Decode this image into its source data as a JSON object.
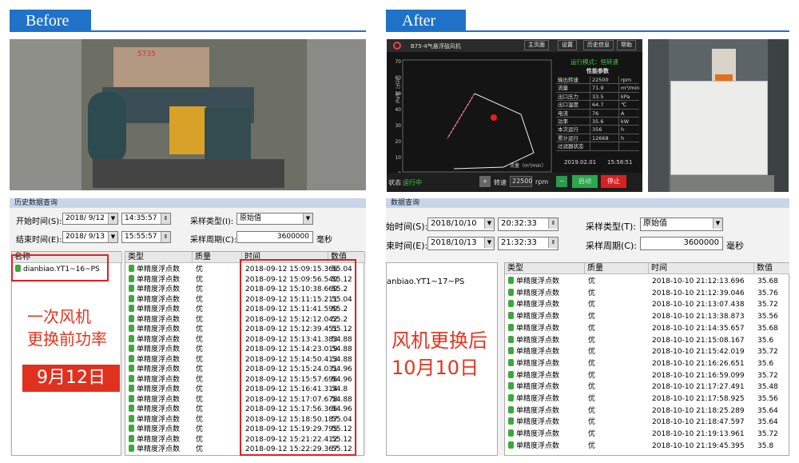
{
  "before": {
    "tag": "Before"
  },
  "after": {
    "tag": "After"
  },
  "scada": {
    "logo": "B75-4气悬浮鼓风机",
    "menu": [
      "主页面",
      "设置",
      "历史信息",
      "帮助"
    ],
    "mode": "运行模式：恒转速",
    "perf_title": "性能参数",
    "params": [
      {
        "k": "输出转速",
        "v": "22500",
        "u": "rpm"
      },
      {
        "k": "流量",
        "v": "71.9",
        "u": "m³/min"
      },
      {
        "k": "出口压力",
        "v": "33.5",
        "u": "kPa"
      },
      {
        "k": "出口温度",
        "v": "64.7",
        "u": "℃"
      },
      {
        "k": "电流",
        "v": "76",
        "u": "A"
      },
      {
        "k": "功率",
        "v": "35.6",
        "u": "kW"
      },
      {
        "k": "本次运行",
        "v": "356",
        "u": "h"
      },
      {
        "k": "累计运行",
        "v": "12668",
        "u": "h"
      },
      {
        "k": "过滤器状态",
        "v": "",
        "u": ""
      }
    ],
    "date": "2019.02.01",
    "time": "15:58:51",
    "ylabel": "压力（kPa）",
    "xlabel": "流量（m³/min）",
    "yticks": [
      "70",
      "60",
      "50",
      "40",
      "30",
      "20",
      "10",
      "0"
    ],
    "xticks": [
      "0",
      "10",
      "20",
      "30",
      "40",
      "50",
      "60",
      "70",
      "80",
      "90",
      "100",
      "110"
    ],
    "status_label": "状态",
    "status": "运行中",
    "plus": "+",
    "speed_label": "转速",
    "speed": "22500",
    "speed_unit": "rpm",
    "minus": "−",
    "start": "启动",
    "stop": "停止"
  },
  "left": {
    "title": "历史数据查询",
    "start_label": "开始时间(S):",
    "start_date": "2018/ 9/12",
    "start_time": "14:35:57",
    "end_label": "结束时间(E):",
    "end_date": "2018/ 9/13",
    "end_time": "15:55:57",
    "type_label": "采样类型(I):",
    "type_val": "原始值",
    "period_label": "采样周期(C):",
    "period_val": "3600000",
    "period_unit": "毫秒",
    "tag_col": "名称",
    "tag": "dianbiao.YT1~16~PS",
    "headers": [
      "类型",
      "质量",
      "时间",
      "数值"
    ],
    "rows": [
      [
        "单精度浮点数",
        "优",
        "2018-09-12 15:09:15.366",
        "55.04"
      ],
      [
        "单精度浮点数",
        "优",
        "2018-09-12 15:09:56.540",
        "55.12"
      ],
      [
        "单精度浮点数",
        "优",
        "2018-09-12 15:10:38.660",
        "55.2"
      ],
      [
        "单精度浮点数",
        "优",
        "2018-09-12 15:11:15.211",
        "55.04"
      ],
      [
        "单精度浮点数",
        "优",
        "2018-09-12 15:11:41.590",
        "55.2"
      ],
      [
        "单精度浮点数",
        "优",
        "2018-09-12 15:12:12.042",
        "55.2"
      ],
      [
        "单精度浮点数",
        "优",
        "2018-09-12 15:12:39.451",
        "55.12"
      ],
      [
        "单精度浮点数",
        "优",
        "2018-09-12 15:13:41.383",
        "54.88"
      ],
      [
        "单精度浮点数",
        "优",
        "2018-09-12 15:14:23.019",
        "54.88"
      ],
      [
        "单精度浮点数",
        "优",
        "2018-09-12 15:14:50.413",
        "54.88"
      ],
      [
        "单精度浮点数",
        "优",
        "2018-09-12 15:15:24.031",
        "54.96"
      ],
      [
        "单精度浮点数",
        "优",
        "2018-09-12 15:15:57.696",
        "54.96"
      ],
      [
        "单精度浮点数",
        "优",
        "2018-09-12 15:16:41.314",
        "54.8"
      ],
      [
        "单精度浮点数",
        "优",
        "2018-09-12 15:17:07.678",
        "54.88"
      ],
      [
        "单精度浮点数",
        "优",
        "2018-09-12 15:17:56.366",
        "54.96"
      ],
      [
        "单精度浮点数",
        "优",
        "2018-09-12 15:18:50.187",
        "55.04"
      ],
      [
        "单精度浮点数",
        "优",
        "2018-09-12 15:19:29.795",
        "55.12"
      ],
      [
        "单精度浮点数",
        "优",
        "2018-09-12 15:21:22.412",
        "55.12"
      ],
      [
        "单精度浮点数",
        "优",
        "2018-09-12 15:22:29.367",
        "55.12"
      ]
    ],
    "note1": "一次风机",
    "note2": "更换前功率",
    "badge": "9月12日"
  },
  "right": {
    "title": "数据查询",
    "start_label": "始时间(S):",
    "start_date": "2018/10/10",
    "start_time": "20:32:33",
    "end_label": "束时间(E):",
    "end_date": "2018/10/13",
    "end_time": "21:32:33",
    "type_label": "采样类型(T):",
    "type_val": "原始值",
    "period_label": "采样周期(C):",
    "period_val": "3600000",
    "period_unit": "毫秒",
    "tag": "anbiao.YT1~17~PS",
    "headers": [
      "类型",
      "质量",
      "时间",
      "数值"
    ],
    "rows": [
      [
        "单精度浮点数",
        "优",
        "2018-10-10 21:12:13.696",
        "35.68"
      ],
      [
        "单精度浮点数",
        "优",
        "2018-10-10 21:12:39.046",
        "35.76"
      ],
      [
        "单精度浮点数",
        "优",
        "2018-10-10 21:13:07.438",
        "35.72"
      ],
      [
        "单精度浮点数",
        "优",
        "2018-10-10 21:13:38.873",
        "35.56"
      ],
      [
        "单精度浮点数",
        "优",
        "2018-10-10 21:14:35.657",
        "35.68"
      ],
      [
        "单精度浮点数",
        "优",
        "2018-10-10 21:15:08.167",
        "35.6"
      ],
      [
        "单精度浮点数",
        "优",
        "2018-10-10 21:15:42.019",
        "35.72"
      ],
      [
        "单精度浮点数",
        "优",
        "2018-10-10 21:16:26.651",
        "35.6"
      ],
      [
        "单精度浮点数",
        "优",
        "2018-10-10 21:16:59.099",
        "35.72"
      ],
      [
        "单精度浮点数",
        "优",
        "2018-10-10 21:17:27.491",
        "35.48"
      ],
      [
        "单精度浮点数",
        "优",
        "2018-10-10 21:17:58.925",
        "35.56"
      ],
      [
        "单精度浮点数",
        "优",
        "2018-10-10 21:18:25.289",
        "35.64"
      ],
      [
        "单精度浮点数",
        "优",
        "2018-10-10 21:18:47.597",
        "35.64"
      ],
      [
        "单精度浮点数",
        "优",
        "2018-10-10 21:19:13.961",
        "35.72"
      ],
      [
        "单精度浮点数",
        "优",
        "2018-10-10 21:19:45.395",
        "35.8"
      ]
    ],
    "note1": "风机更换后",
    "note2": "10月10日"
  }
}
